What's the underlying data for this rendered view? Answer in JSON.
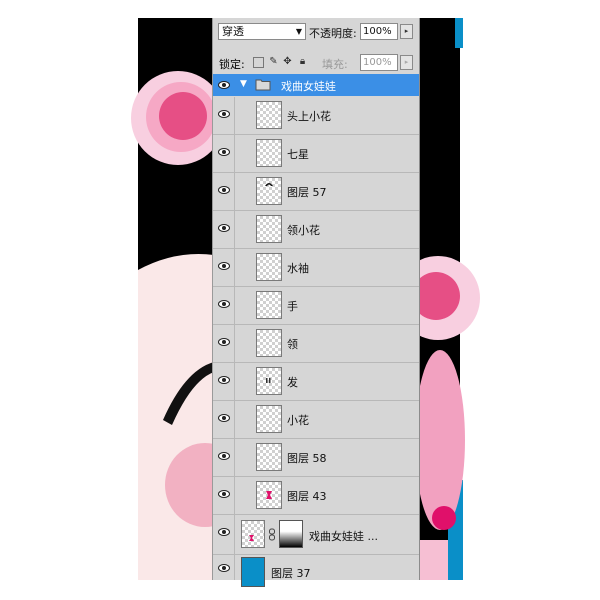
{
  "panel": {
    "blend_mode": "穿透",
    "opacity_label": "不透明度:",
    "opacity_value": "100%",
    "lock_label": "锁定:",
    "fill_label": "填充:",
    "fill_value": "100%"
  },
  "group": {
    "name": "戏曲女娃娃",
    "selected": true
  },
  "layers": [
    {
      "name": "头上小花"
    },
    {
      "name": "七星"
    },
    {
      "name": "图层 57"
    },
    {
      "name": "领小花"
    },
    {
      "name": "水袖"
    },
    {
      "name": "手"
    },
    {
      "name": "领"
    },
    {
      "name": "发"
    },
    {
      "name": "小花"
    },
    {
      "name": "图层 58"
    },
    {
      "name": "图层 43"
    }
  ],
  "masked_layer": {
    "name": "戏曲女娃娃 ..."
  },
  "bottom_layer": {
    "name": "图层 37",
    "color": "#0a8fc8"
  },
  "colors": {
    "selection": "#3b8fe6",
    "panel": "#d6d6d6",
    "canvas_pink": "#f9e8e8",
    "flower_pink": "#ee5a8e"
  }
}
